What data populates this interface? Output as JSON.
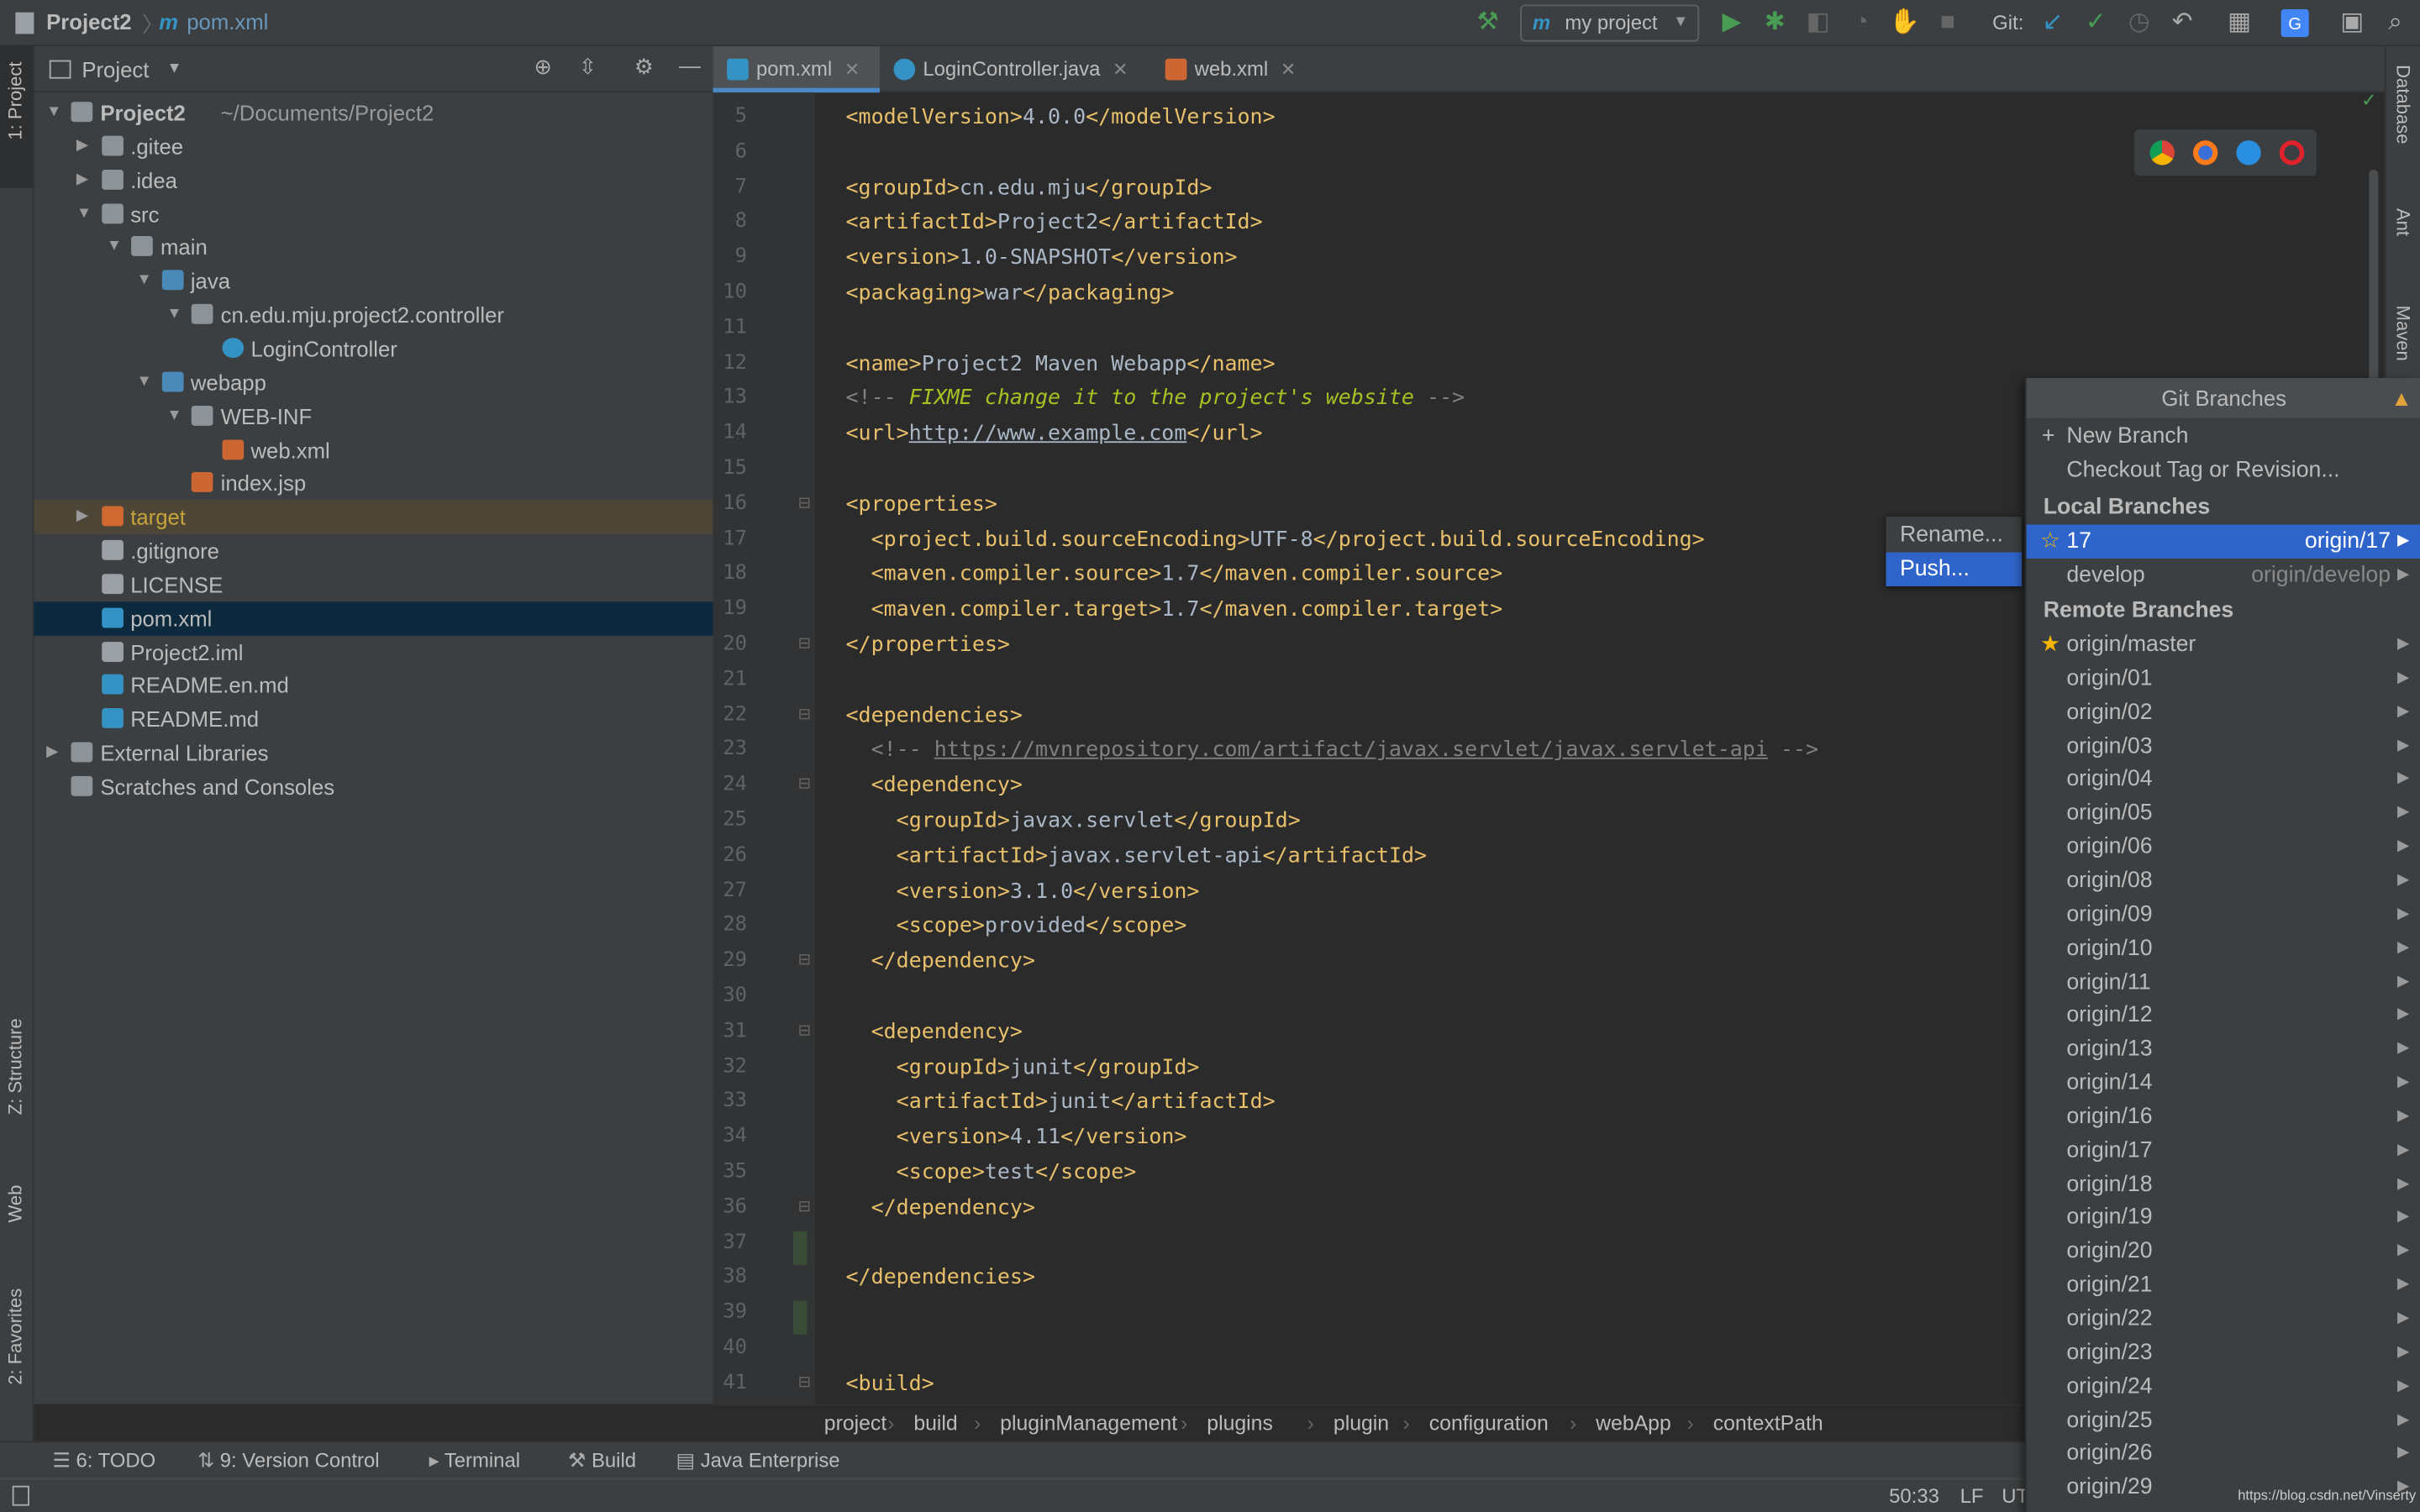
{
  "titlebar": {
    "project": "Project2",
    "file": "pom.xml",
    "run_config": "my project",
    "git_label": "Git:"
  },
  "colors": {
    "accent": "#2f65ca",
    "tag": "#e8bf6a",
    "comment": "#808080",
    "fixme": "#a8c023",
    "run_green": "#499c54",
    "warning": "#e0a33a"
  },
  "left_strip": {
    "project_tab": "1: Project",
    "structure_tab": "Z: Structure",
    "web_tab": "Web",
    "favorites_tab": "2: Favorites"
  },
  "right_strip": {
    "database_tab": "Database",
    "ant_tab": "Ant",
    "maven_tab": "Maven"
  },
  "project_panel": {
    "title": "Project",
    "tree": [
      {
        "label": "Project2",
        "extra": "~/Documents/Project2",
        "depth": 0,
        "arrow": "down",
        "icon": "folder",
        "bold": true
      },
      {
        "label": ".gitee",
        "depth": 1,
        "arrow": "right",
        "icon": "folder"
      },
      {
        "label": ".idea",
        "depth": 1,
        "arrow": "right",
        "icon": "folder"
      },
      {
        "label": "src",
        "depth": 1,
        "arrow": "down",
        "icon": "folder"
      },
      {
        "label": "main",
        "depth": 2,
        "arrow": "down",
        "icon": "folder"
      },
      {
        "label": "java",
        "depth": 3,
        "arrow": "down",
        "icon": "folder-blue"
      },
      {
        "label": "cn.edu.mju.project2.controller",
        "depth": 4,
        "arrow": "down",
        "icon": "package"
      },
      {
        "label": "LoginController",
        "depth": 5,
        "icon": "class"
      },
      {
        "label": "webapp",
        "depth": 3,
        "arrow": "down",
        "icon": "folder-web"
      },
      {
        "label": "WEB-INF",
        "depth": 4,
        "arrow": "down",
        "icon": "folder"
      },
      {
        "label": "web.xml",
        "depth": 5,
        "icon": "xml"
      },
      {
        "label": "index.jsp",
        "depth": 4,
        "icon": "jsp"
      },
      {
        "label": "target",
        "depth": 1,
        "arrow": "right",
        "icon": "folder-orange",
        "excluded": true
      },
      {
        "label": ".gitignore",
        "depth": 1,
        "icon": "file"
      },
      {
        "label": "LICENSE",
        "depth": 1,
        "icon": "file"
      },
      {
        "label": "pom.xml",
        "depth": 1,
        "icon": "maven",
        "selected": true
      },
      {
        "label": "Project2.iml",
        "depth": 1,
        "icon": "file"
      },
      {
        "label": "README.en.md",
        "depth": 1,
        "icon": "md"
      },
      {
        "label": "README.md",
        "depth": 1,
        "icon": "md"
      },
      {
        "label": "External Libraries",
        "depth": 0,
        "arrow": "right",
        "icon": "library"
      },
      {
        "label": "Scratches and Consoles",
        "depth": 0,
        "icon": "scratch"
      }
    ]
  },
  "tabs": [
    {
      "label": "pom.xml",
      "icon": "maven",
      "active": true
    },
    {
      "label": "LoginController.java",
      "icon": "class"
    },
    {
      "label": "web.xml",
      "icon": "xml"
    }
  ],
  "code": [
    {
      "n": "5",
      "segs": [
        [
          "tag",
          "<modelVersion>"
        ],
        [
          "txt",
          "4.0.0"
        ],
        [
          "tag",
          "</modelVersion>"
        ]
      ]
    },
    {
      "n": "6",
      "segs": []
    },
    {
      "n": "7",
      "segs": [
        [
          "tag",
          "<groupId>"
        ],
        [
          "txt",
          "cn.edu.mju"
        ],
        [
          "tag",
          "</groupId>"
        ]
      ]
    },
    {
      "n": "8",
      "segs": [
        [
          "tag",
          "<artifactId>"
        ],
        [
          "txt",
          "Project2"
        ],
        [
          "tag",
          "</artifactId>"
        ]
      ]
    },
    {
      "n": "9",
      "segs": [
        [
          "tag",
          "<version>"
        ],
        [
          "txt",
          "1.0-SNAPSHOT"
        ],
        [
          "tag",
          "</version>"
        ]
      ]
    },
    {
      "n": "10",
      "segs": [
        [
          "tag",
          "<packaging>"
        ],
        [
          "txt",
          "war"
        ],
        [
          "tag",
          "</packaging>"
        ]
      ]
    },
    {
      "n": "11",
      "segs": []
    },
    {
      "n": "12",
      "segs": [
        [
          "tag",
          "<name>"
        ],
        [
          "txt",
          "Project2 Maven Webapp"
        ],
        [
          "tag",
          "</name>"
        ]
      ]
    },
    {
      "n": "13",
      "segs": [
        [
          "cmt",
          "<!-- "
        ],
        [
          "fix",
          "FIXME change it to the project's website"
        ],
        [
          "cmt",
          " -->"
        ]
      ]
    },
    {
      "n": "14",
      "segs": [
        [
          "tag",
          "<url>"
        ],
        [
          "url",
          "http://www.example.com"
        ],
        [
          "tag",
          "</url>"
        ]
      ]
    },
    {
      "n": "15",
      "segs": []
    },
    {
      "n": "16",
      "segs": [
        [
          "tag",
          "<properties>"
        ]
      ]
    },
    {
      "n": "17",
      "segs": [
        [
          "txt",
          "  "
        ],
        [
          "tag",
          "<project.build.sourceEncoding>"
        ],
        [
          "txt",
          "UTF-8"
        ],
        [
          "tag",
          "</project.build.sourceEncoding>"
        ]
      ]
    },
    {
      "n": "18",
      "segs": [
        [
          "txt",
          "  "
        ],
        [
          "tag",
          "<maven.compiler.source>"
        ],
        [
          "txt",
          "1.7"
        ],
        [
          "tag",
          "</maven.compiler.source>"
        ]
      ]
    },
    {
      "n": "19",
      "segs": [
        [
          "txt",
          "  "
        ],
        [
          "tag",
          "<maven.compiler.target>"
        ],
        [
          "txt",
          "1.7"
        ],
        [
          "tag",
          "</maven.compiler.target>"
        ]
      ]
    },
    {
      "n": "20",
      "segs": [
        [
          "tag",
          "</properties>"
        ]
      ]
    },
    {
      "n": "21",
      "segs": []
    },
    {
      "n": "22",
      "segs": [
        [
          "tag",
          "<dependencies>"
        ]
      ]
    },
    {
      "n": "23",
      "segs": [
        [
          "txt",
          "  "
        ],
        [
          "cmt",
          "<!-- "
        ],
        [
          "curl",
          "https://mvnrepository.com/artifact/javax.servlet/javax.servlet-api"
        ],
        [
          "cmt",
          " -->"
        ]
      ]
    },
    {
      "n": "24",
      "segs": [
        [
          "txt",
          "  "
        ],
        [
          "tag",
          "<dependency>"
        ]
      ]
    },
    {
      "n": "25",
      "segs": [
        [
          "txt",
          "    "
        ],
        [
          "tag",
          "<groupId>"
        ],
        [
          "txt",
          "javax.servlet"
        ],
        [
          "tag",
          "</groupId>"
        ]
      ]
    },
    {
      "n": "26",
      "segs": [
        [
          "txt",
          "    "
        ],
        [
          "tag",
          "<artifactId>"
        ],
        [
          "txt",
          "javax.servlet-api"
        ],
        [
          "tag",
          "</artifactId>"
        ]
      ]
    },
    {
      "n": "27",
      "segs": [
        [
          "txt",
          "    "
        ],
        [
          "tag",
          "<version>"
        ],
        [
          "txt",
          "3.1.0"
        ],
        [
          "tag",
          "</version>"
        ]
      ]
    },
    {
      "n": "28",
      "segs": [
        [
          "txt",
          "    "
        ],
        [
          "tag",
          "<scope>"
        ],
        [
          "txt",
          "provided"
        ],
        [
          "tag",
          "</scope>"
        ]
      ]
    },
    {
      "n": "29",
      "segs": [
        [
          "txt",
          "  "
        ],
        [
          "tag",
          "</dependency>"
        ]
      ]
    },
    {
      "n": "30",
      "segs": []
    },
    {
      "n": "31",
      "segs": [
        [
          "txt",
          "  "
        ],
        [
          "tag",
          "<dependency>"
        ]
      ]
    },
    {
      "n": "32",
      "segs": [
        [
          "txt",
          "    "
        ],
        [
          "tag",
          "<groupId>"
        ],
        [
          "txt",
          "junit"
        ],
        [
          "tag",
          "</groupId>"
        ]
      ]
    },
    {
      "n": "33",
      "segs": [
        [
          "txt",
          "    "
        ],
        [
          "tag",
          "<artifactId>"
        ],
        [
          "txt",
          "junit"
        ],
        [
          "tag",
          "</artifactId>"
        ]
      ]
    },
    {
      "n": "34",
      "segs": [
        [
          "txt",
          "    "
        ],
        [
          "tag",
          "<version>"
        ],
        [
          "txt",
          "4.11"
        ],
        [
          "tag",
          "</version>"
        ]
      ]
    },
    {
      "n": "35",
      "segs": [
        [
          "txt",
          "    "
        ],
        [
          "tag",
          "<scope>"
        ],
        [
          "txt",
          "test"
        ],
        [
          "tag",
          "</scope>"
        ]
      ]
    },
    {
      "n": "36",
      "segs": [
        [
          "txt",
          "  "
        ],
        [
          "tag",
          "</dependency>"
        ]
      ]
    },
    {
      "n": "37",
      "segs": []
    },
    {
      "n": "38",
      "segs": [
        [
          "tag",
          "</dependencies>"
        ]
      ]
    },
    {
      "n": "39",
      "segs": []
    },
    {
      "n": "40",
      "segs": []
    },
    {
      "n": "41",
      "segs": [
        [
          "tag",
          "<build>"
        ]
      ]
    }
  ],
  "breadcrumb": [
    "project",
    "build",
    "pluginManagement",
    "plugins",
    "plugin",
    "configuration",
    "webApp",
    "contextPath"
  ],
  "bottom_tools": [
    {
      "label": "6: TODO",
      "icon": "list-icon"
    },
    {
      "label": "9: Version Control",
      "icon": "vcs-icon"
    },
    {
      "label": "Terminal",
      "icon": "terminal-icon"
    },
    {
      "label": "Build",
      "icon": "hammer-icon"
    },
    {
      "label": "Java Enterprise",
      "icon": "java-ee-icon"
    }
  ],
  "status": {
    "position": "50:33",
    "line_sep": "LF",
    "encoding": "UT",
    "watermark": "https://blog.csdn.net/Vinserty"
  },
  "git_popup": {
    "title": "Git Branches",
    "new_branch": "New Branch",
    "checkout": "Checkout Tag or Revision...",
    "local_header": "Local Branches",
    "local": [
      {
        "name": "17",
        "tracking": "origin/17",
        "current": true
      },
      {
        "name": "develop",
        "tracking": "origin/develop"
      }
    ],
    "remote_header": "Remote Branches",
    "remote": [
      "origin/master",
      "origin/01",
      "origin/02",
      "origin/03",
      "origin/04",
      "origin/05",
      "origin/06",
      "origin/08",
      "origin/09",
      "origin/10",
      "origin/11",
      "origin/12",
      "origin/13",
      "origin/14",
      "origin/16",
      "origin/17",
      "origin/18",
      "origin/19",
      "origin/20",
      "origin/21",
      "origin/22",
      "origin/23",
      "origin/24",
      "origin/25",
      "origin/26",
      "origin/29"
    ],
    "submenu": [
      "Rename...",
      "Push..."
    ]
  }
}
